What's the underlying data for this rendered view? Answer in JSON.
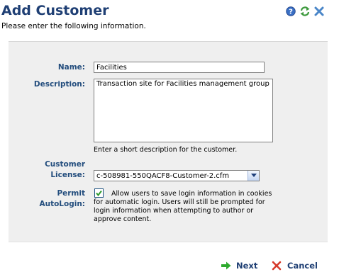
{
  "page": {
    "title": "Add Customer",
    "subtitle": "Please enter the following information."
  },
  "top_icons": [
    "help-icon",
    "refresh-icon",
    "close-icon"
  ],
  "colors": {
    "title": "#1f3f74",
    "label": "#234d7d",
    "panel_bg": "#efefef",
    "next_arrow": "#2eaa2e",
    "cancel_x": "#d63a2b",
    "checkbox_check": "#2e9a2e"
  },
  "form": {
    "name": {
      "label": "Name:",
      "value": "Facilities"
    },
    "description": {
      "label": "Description:",
      "value": "Transaction site for Facilities management group",
      "hint": "Enter a short description for the customer."
    },
    "license": {
      "label_line1": "Customer",
      "label_line2": "License:",
      "selected": "c-508981-550QACF8-Customer-2.cfm"
    },
    "autologin": {
      "label_line1": "Permit",
      "label_line2": "AutoLogin:",
      "checked": true,
      "text_first": "Allow users to save login information in cookies",
      "text_rest": "for automatic login. Users will still be prompted for\nlogin information when attempting to author or\napprove content."
    }
  },
  "buttons": {
    "next": "Next",
    "cancel": "Cancel"
  }
}
